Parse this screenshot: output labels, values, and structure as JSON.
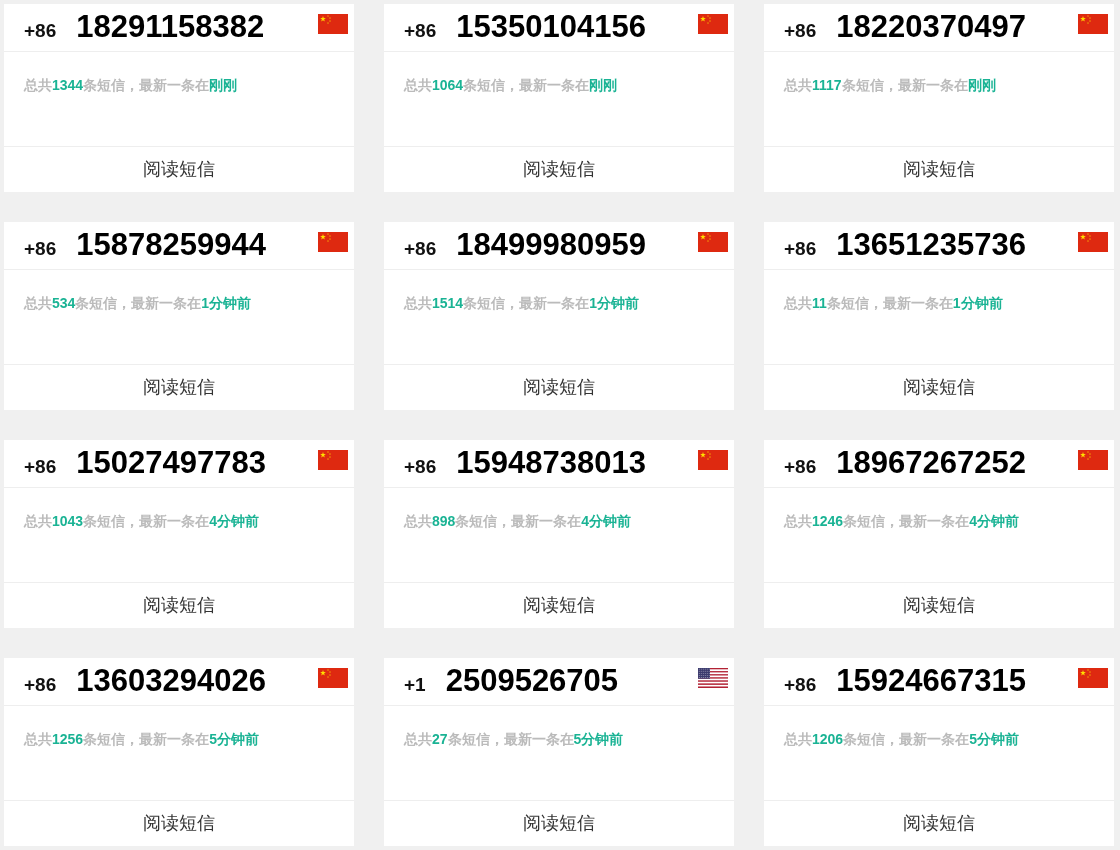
{
  "cards": [
    {
      "country_code": "+86",
      "number": "18291158382",
      "flag": {
        "kind": "cn"
      },
      "summary": [
        {
          "text": "总共",
          "highlight": false
        },
        {
          "text": "1344",
          "highlight": true
        },
        {
          "text": "条短信，最新一条在",
          "highlight": false
        },
        {
          "text": "刚刚",
          "highlight": true
        }
      ],
      "button": "阅读短信"
    },
    {
      "country_code": "+86",
      "number": "15350104156",
      "flag": {
        "kind": "cn"
      },
      "summary": [
        {
          "text": "总共",
          "highlight": false
        },
        {
          "text": "1064",
          "highlight": true
        },
        {
          "text": "条短信，最新一条在",
          "highlight": false
        },
        {
          "text": "刚刚",
          "highlight": true
        }
      ],
      "button": "阅读短信"
    },
    {
      "country_code": "+86",
      "number": "18220370497",
      "flag": {
        "kind": "cn"
      },
      "summary": [
        {
          "text": "总共",
          "highlight": false
        },
        {
          "text": "1117",
          "highlight": true
        },
        {
          "text": "条短信，最新一条在",
          "highlight": false
        },
        {
          "text": "刚刚",
          "highlight": true
        }
      ],
      "button": "阅读短信"
    },
    {
      "country_code": "+86",
      "number": "15878259944",
      "flag": {
        "kind": "cn"
      },
      "summary": [
        {
          "text": "总共",
          "highlight": false
        },
        {
          "text": "534",
          "highlight": true
        },
        {
          "text": "条短信，最新一条在",
          "highlight": false
        },
        {
          "text": "1分钟前",
          "highlight": true
        }
      ],
      "button": "阅读短信"
    },
    {
      "country_code": "+86",
      "number": "18499980959",
      "flag": {
        "kind": "cn"
      },
      "summary": [
        {
          "text": "总共",
          "highlight": false
        },
        {
          "text": "1514",
          "highlight": true
        },
        {
          "text": "条短信，最新一条在",
          "highlight": false
        },
        {
          "text": "1分钟前",
          "highlight": true
        }
      ],
      "button": "阅读短信"
    },
    {
      "country_code": "+86",
      "number": "13651235736",
      "flag": {
        "kind": "cn"
      },
      "summary": [
        {
          "text": "总共",
          "highlight": false
        },
        {
          "text": "11",
          "highlight": true
        },
        {
          "text": "条短信，最新一条在",
          "highlight": false
        },
        {
          "text": "1分钟前",
          "highlight": true
        }
      ],
      "button": "阅读短信"
    },
    {
      "country_code": "+86",
      "number": "15027497783",
      "flag": {
        "kind": "cn"
      },
      "summary": [
        {
          "text": "总共",
          "highlight": false
        },
        {
          "text": "1043",
          "highlight": true
        },
        {
          "text": "条短信，最新一条在",
          "highlight": false
        },
        {
          "text": "4分钟前",
          "highlight": true
        }
      ],
      "button": "阅读短信"
    },
    {
      "country_code": "+86",
      "number": "15948738013",
      "flag": {
        "kind": "cn"
      },
      "summary": [
        {
          "text": "总共",
          "highlight": false
        },
        {
          "text": "898",
          "highlight": true
        },
        {
          "text": "条短信，最新一条在",
          "highlight": false
        },
        {
          "text": "4分钟前",
          "highlight": true
        }
      ],
      "button": "阅读短信"
    },
    {
      "country_code": "+86",
      "number": "18967267252",
      "flag": {
        "kind": "cn"
      },
      "summary": [
        {
          "text": "总共",
          "highlight": false
        },
        {
          "text": "1246",
          "highlight": true
        },
        {
          "text": "条短信，最新一条在",
          "highlight": false
        },
        {
          "text": "4分钟前",
          "highlight": true
        }
      ],
      "button": "阅读短信"
    },
    {
      "country_code": "+86",
      "number": "13603294026",
      "flag": {
        "kind": "cn"
      },
      "summary": [
        {
          "text": "总共",
          "highlight": false
        },
        {
          "text": "1256",
          "highlight": true
        },
        {
          "text": "条短信，最新一条在",
          "highlight": false
        },
        {
          "text": "5分钟前",
          "highlight": true
        }
      ],
      "button": "阅读短信"
    },
    {
      "country_code": "+1",
      "number": "2509526705",
      "flag": {
        "kind": "us"
      },
      "summary": [
        {
          "text": "总共",
          "highlight": false
        },
        {
          "text": "27",
          "highlight": true
        },
        {
          "text": "条短信，最新一条在",
          "highlight": false
        },
        {
          "text": "5分钟前",
          "highlight": true
        }
      ],
      "button": "阅读短信"
    },
    {
      "country_code": "+86",
      "number": "15924667315",
      "flag": {
        "kind": "cn"
      },
      "summary": [
        {
          "text": "总共",
          "highlight": false
        },
        {
          "text": "1206",
          "highlight": true
        },
        {
          "text": "条短信，最新一条在",
          "highlight": false
        },
        {
          "text": "5分钟前",
          "highlight": true
        }
      ],
      "button": "阅读短信"
    }
  ]
}
